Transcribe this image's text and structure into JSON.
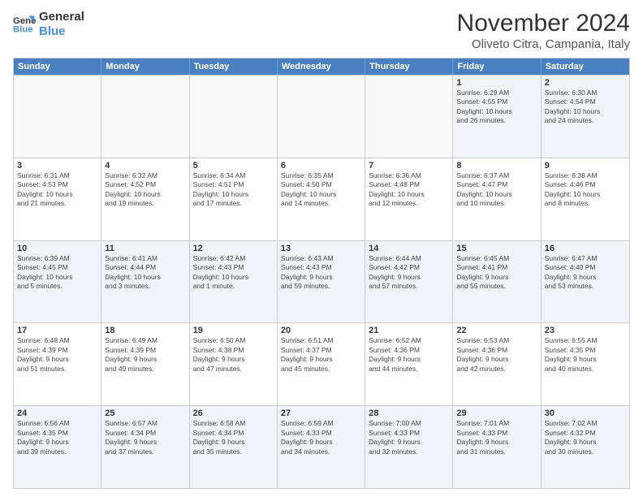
{
  "logo": {
    "line1": "General",
    "line2": "Blue"
  },
  "title": "November 2024",
  "subtitle": "Oliveto Citra, Campania, Italy",
  "days": [
    "Sunday",
    "Monday",
    "Tuesday",
    "Wednesday",
    "Thursday",
    "Friday",
    "Saturday"
  ],
  "weeks": [
    [
      {
        "day": "",
        "info": ""
      },
      {
        "day": "",
        "info": ""
      },
      {
        "day": "",
        "info": ""
      },
      {
        "day": "",
        "info": ""
      },
      {
        "day": "",
        "info": ""
      },
      {
        "day": "1",
        "info": "Sunrise: 6:29 AM\nSunset: 4:55 PM\nDaylight: 10 hours\nand 26 minutes."
      },
      {
        "day": "2",
        "info": "Sunrise: 6:30 AM\nSunset: 4:54 PM\nDaylight: 10 hours\nand 24 minutes."
      }
    ],
    [
      {
        "day": "3",
        "info": "Sunrise: 6:31 AM\nSunset: 4:53 PM\nDaylight: 10 hours\nand 21 minutes."
      },
      {
        "day": "4",
        "info": "Sunrise: 6:32 AM\nSunset: 4:52 PM\nDaylight: 10 hours\nand 19 minutes."
      },
      {
        "day": "5",
        "info": "Sunrise: 6:34 AM\nSunset: 4:51 PM\nDaylight: 10 hours\nand 17 minutes."
      },
      {
        "day": "6",
        "info": "Sunrise: 6:35 AM\nSunset: 4:50 PM\nDaylight: 10 hours\nand 14 minutes."
      },
      {
        "day": "7",
        "info": "Sunrise: 6:36 AM\nSunset: 4:48 PM\nDaylight: 10 hours\nand 12 minutes."
      },
      {
        "day": "8",
        "info": "Sunrise: 6:37 AM\nSunset: 4:47 PM\nDaylight: 10 hours\nand 10 minutes."
      },
      {
        "day": "9",
        "info": "Sunrise: 6:38 AM\nSunset: 4:46 PM\nDaylight: 10 hours\nand 8 minutes."
      }
    ],
    [
      {
        "day": "10",
        "info": "Sunrise: 6:39 AM\nSunset: 4:45 PM\nDaylight: 10 hours\nand 5 minutes."
      },
      {
        "day": "11",
        "info": "Sunrise: 6:41 AM\nSunset: 4:44 PM\nDaylight: 10 hours\nand 3 minutes."
      },
      {
        "day": "12",
        "info": "Sunrise: 6:42 AM\nSunset: 4:43 PM\nDaylight: 10 hours\nand 1 minute."
      },
      {
        "day": "13",
        "info": "Sunrise: 6:43 AM\nSunset: 4:43 PM\nDaylight: 9 hours\nand 59 minutes."
      },
      {
        "day": "14",
        "info": "Sunrise: 6:44 AM\nSunset: 4:42 PM\nDaylight: 9 hours\nand 57 minutes."
      },
      {
        "day": "15",
        "info": "Sunrise: 6:45 AM\nSunset: 4:41 PM\nDaylight: 9 hours\nand 55 minutes."
      },
      {
        "day": "16",
        "info": "Sunrise: 6:47 AM\nSunset: 4:40 PM\nDaylight: 9 hours\nand 53 minutes."
      }
    ],
    [
      {
        "day": "17",
        "info": "Sunrise: 6:48 AM\nSunset: 4:39 PM\nDaylight: 9 hours\nand 51 minutes."
      },
      {
        "day": "18",
        "info": "Sunrise: 6:49 AM\nSunset: 4:39 PM\nDaylight: 9 hours\nand 49 minutes."
      },
      {
        "day": "19",
        "info": "Sunrise: 6:50 AM\nSunset: 4:38 PM\nDaylight: 9 hours\nand 47 minutes."
      },
      {
        "day": "20",
        "info": "Sunrise: 6:51 AM\nSunset: 4:37 PM\nDaylight: 9 hours\nand 45 minutes."
      },
      {
        "day": "21",
        "info": "Sunrise: 6:52 AM\nSunset: 4:36 PM\nDaylight: 9 hours\nand 44 minutes."
      },
      {
        "day": "22",
        "info": "Sunrise: 6:53 AM\nSunset: 4:36 PM\nDaylight: 9 hours\nand 42 minutes."
      },
      {
        "day": "23",
        "info": "Sunrise: 6:55 AM\nSunset: 4:35 PM\nDaylight: 9 hours\nand 40 minutes."
      }
    ],
    [
      {
        "day": "24",
        "info": "Sunrise: 6:56 AM\nSunset: 4:35 PM\nDaylight: 9 hours\nand 39 minutes."
      },
      {
        "day": "25",
        "info": "Sunrise: 6:57 AM\nSunset: 4:34 PM\nDaylight: 9 hours\nand 37 minutes."
      },
      {
        "day": "26",
        "info": "Sunrise: 6:58 AM\nSunset: 4:34 PM\nDaylight: 9 hours\nand 35 minutes."
      },
      {
        "day": "27",
        "info": "Sunrise: 6:59 AM\nSunset: 4:33 PM\nDaylight: 9 hours\nand 34 minutes."
      },
      {
        "day": "28",
        "info": "Sunrise: 7:00 AM\nSunset: 4:33 PM\nDaylight: 9 hours\nand 32 minutes."
      },
      {
        "day": "29",
        "info": "Sunrise: 7:01 AM\nSunset: 4:33 PM\nDaylight: 9 hours\nand 31 minutes."
      },
      {
        "day": "30",
        "info": "Sunrise: 7:02 AM\nSunset: 4:32 PM\nDaylight: 9 hours\nand 30 minutes."
      }
    ]
  ]
}
